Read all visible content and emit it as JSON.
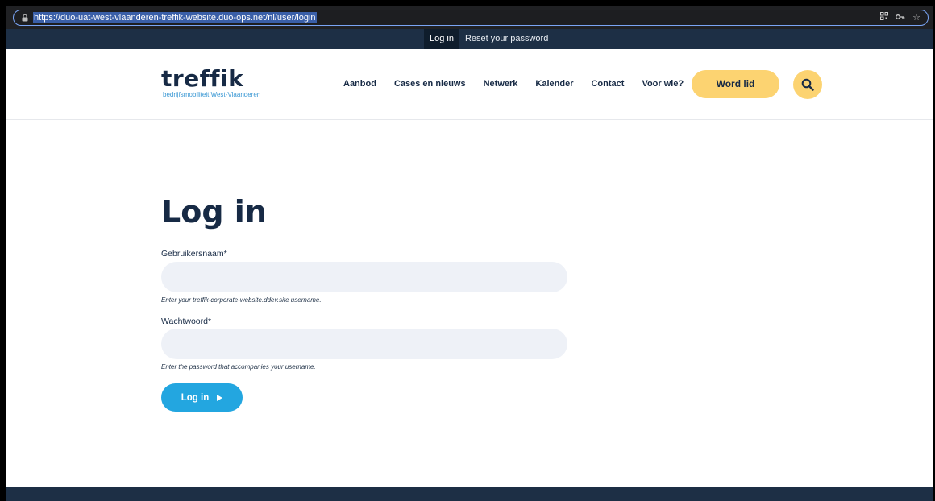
{
  "browser": {
    "url": "https://duo-uat-west-vlaanderen-treffik-website.duo-ops.net/nl/user/login",
    "icons": [
      "qr-code-icon",
      "key-icon",
      "star-icon"
    ]
  },
  "admin_tabs": [
    {
      "label": "Log in",
      "active": true
    },
    {
      "label": "Reset your password",
      "active": false
    }
  ],
  "header": {
    "logo_text": "treffik",
    "logo_tagline": "bedrijfsmobiliteit West-Vlaanderen",
    "nav": [
      "Aanbod",
      "Cases en nieuws",
      "Netwerk",
      "Kalender",
      "Contact",
      "Voor wie?"
    ],
    "cta_label": "Word lid",
    "search_icon": "search-icon"
  },
  "login": {
    "title": "Log in",
    "username_label": "Gebruikersnaam*",
    "username_value": "",
    "username_help": "Enter your treffik-corporate-website.ddev.site username.",
    "password_label": "Wachtwoord*",
    "password_value": "",
    "password_help": "Enter the password that accompanies your username.",
    "submit_label": "Log in"
  },
  "colors": {
    "navy": "#172a45",
    "yellow": "#fcd371",
    "blue": "#23a6e0",
    "input_bg": "#eef1f7"
  }
}
